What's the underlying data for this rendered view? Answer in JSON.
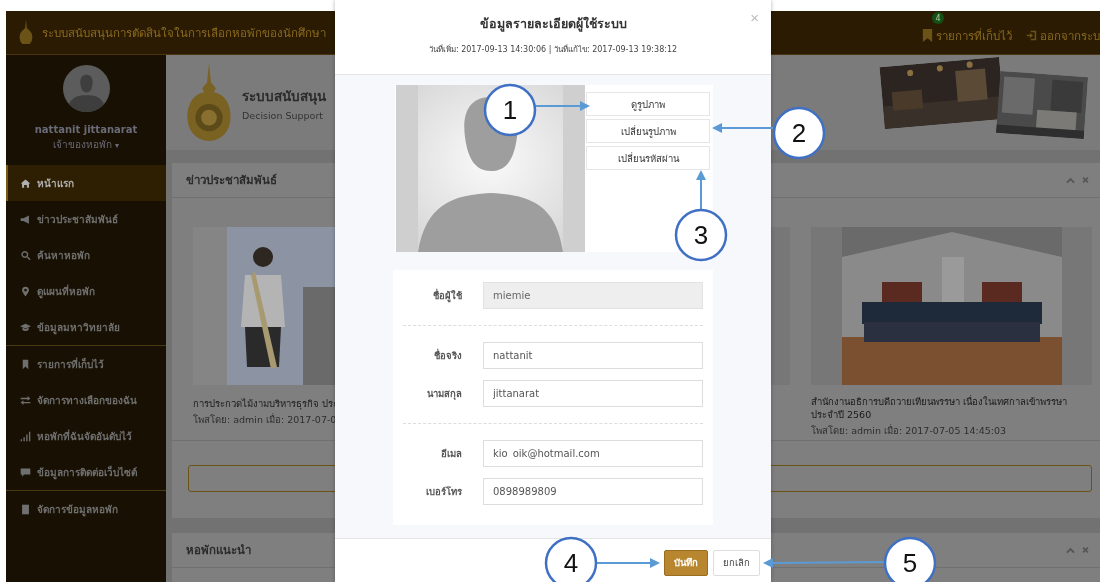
{
  "top_bar": {
    "title": "ระบบสนับสนุนการตัดสินใจในการเลือกหอพักของนักศึกษา",
    "saved": {
      "label": "รายการที่เก็บไว้",
      "count": "4"
    },
    "logout": "ออกจากระบ"
  },
  "user": {
    "name": "nattanit  jittanarat",
    "role": "เจ้าของหอพัก",
    "caret": "▾"
  },
  "sidebar": {
    "sections": [
      {
        "items": [
          {
            "label": "หน้าแรก",
            "selected": true
          },
          {
            "label": "ข่าวประชาสัมพันธ์",
            "selected": false
          },
          {
            "label": "ค้นหาหอพัก",
            "selected": false
          },
          {
            "label": "ดูแผนที่หอพัก",
            "selected": false
          },
          {
            "label": "ข้อมูลมหาวิทยาลัย",
            "selected": false
          }
        ]
      },
      {
        "items": [
          {
            "label": "รายการที่เก็บไว้",
            "selected": false
          },
          {
            "label": "จัดการทางเลือกของฉัน",
            "selected": false
          },
          {
            "label": "หอพักที่ฉันจัดอันดับไว้",
            "selected": false
          },
          {
            "label": "ข้อมูลการติดต่อเว็บไซต์",
            "selected": false
          }
        ]
      },
      {
        "items": [
          {
            "label": "จัดการข้อมูลหอพัก",
            "selected": false
          }
        ]
      }
    ]
  },
  "header": {
    "title": "ระบบสนับสนุน",
    "subtitle": "Decision Support"
  },
  "news_panel": {
    "title": "ข่าวประชาสัมพันธ์",
    "cards": [
      {
        "caption": "การประกวดไม้งามบริหารธุรกิจ ประ",
        "meta": "โพสโดย: admin เมื่อ: 2017-07-0"
      },
      {
        "caption": "สำนักงานอธิการบดีถวายเทียนพรรษา เนื่องในเทศกาลเข้าพรรษา ประจำปี 2560",
        "meta": "โพสโดย: admin เมื่อ: 2017-07-05 14:45:03"
      }
    ]
  },
  "recommended_panel": {
    "title": "หอพักแนะนำ"
  },
  "modal": {
    "title": "ข้อมูลรายละเอียดผู้ใช้ระบบ",
    "subtitle": "วันที่เพิ่ม: 2017-09-13 14:30:06 | วันที่แก้ไข: 2017-09-13 19:38:12",
    "close": "×",
    "photo_actions": [
      "ดูรูปภาพ",
      "เปลี่ยนรูปภาพ",
      "เปลี่ยนรหัสผ่าน"
    ],
    "field_groups": [
      [
        {
          "label": "ชื่อผู้ใช้",
          "value": "miemie",
          "disabled": true
        }
      ],
      [
        {
          "label": "ชื่อจริง",
          "value": "nattanit",
          "disabled": false
        },
        {
          "label": "นามสกุล",
          "value": "jittanarat",
          "disabled": false
        }
      ],
      [
        {
          "label": "อีเมล",
          "value": "kio_oik@hotmail.com",
          "disabled": false
        },
        {
          "label": "เบอร์โทร",
          "value": "0898989809",
          "disabled": false
        }
      ]
    ],
    "buttons": [
      {
        "label": "บันทึก",
        "kind": "primary"
      },
      {
        "label": "ยกเลิก",
        "kind": "default"
      }
    ]
  },
  "annotations": [
    "1",
    "2",
    "3",
    "4",
    "5"
  ]
}
